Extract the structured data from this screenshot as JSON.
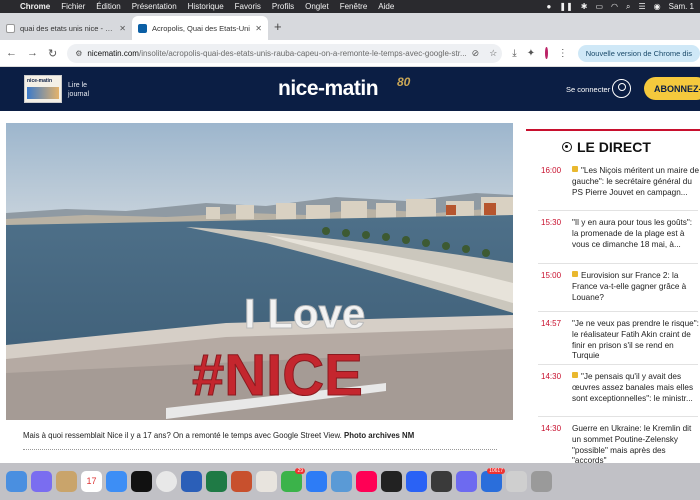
{
  "menubar": {
    "items": [
      "Chrome",
      "Fichier",
      "Édition",
      "Présentation",
      "Historique",
      "Favoris",
      "Profils",
      "Onglet",
      "Fenêtre",
      "Aide"
    ],
    "clock": "Sam. 1"
  },
  "tabs": [
    {
      "title": "quai des etats unis nice - Rec",
      "active": false
    },
    {
      "title": "Acropolis, Quai des Etats-Uni",
      "active": true
    }
  ],
  "address": {
    "host": "nicematin.com",
    "path": "/insolite/acropolis-quai-des-etats-unis-rauba-capeu-on-a-remonte-le-temps-avec-google-str...",
    "chrome_update": "Nouvelle version de Chrome dis"
  },
  "site": {
    "read_journal": "Lire le journal",
    "logo_text": "nice-matin",
    "brand": "nice-matin",
    "brand_sup": "80",
    "connect": "Se connecter",
    "subscribe": "ABONNEZ-"
  },
  "photo": {
    "sign_line1": "I Love",
    "sign_line2": "#NICE"
  },
  "caption": {
    "text": "Mais à quoi ressemblait Nice il y a 17 ans? On a remonté le temps avec Google Street View. ",
    "credit": "Photo archives NM"
  },
  "live": {
    "title": "LE DIRECT",
    "items": [
      {
        "time": "16:00",
        "locked": true,
        "text": "\"Les Niçois méritent un maire de gauche\": le secrétaire général du PS Pierre Jouvet en campagn..."
      },
      {
        "time": "15:30",
        "locked": false,
        "text": "\"Il y en aura pour tous les goûts\": la promenade de la plage est à vous ce dimanche 18 mai, à..."
      },
      {
        "time": "15:00",
        "locked": true,
        "text": "Eurovision sur France 2: la France va-t-elle gagner grâce à Louane?"
      },
      {
        "time": "14:57",
        "locked": false,
        "text": "\"Je ne veux pas prendre le risque\": le réalisateur Fatih Akin craint de finir en prison s'il se rend en Turquie"
      },
      {
        "time": "14:30",
        "locked": true,
        "text": "\"Je pensais qu'il y avait des œuvres assez banales mais elles sont exceptionnelles\": le ministr..."
      },
      {
        "time": "14:30",
        "locked": false,
        "text": "Guerre en Ukraine: le Kremlin dit un sommet Poutine-Zelensky \"possible\" mais après des \"accords\""
      }
    ]
  },
  "dock": {
    "calendar_day": "17",
    "badges": [
      "29",
      "10617"
    ]
  },
  "colors": {
    "header_bg": "#0b1e44",
    "accent_red": "#c8102e",
    "subscribe_yellow": "#f5c93d"
  }
}
